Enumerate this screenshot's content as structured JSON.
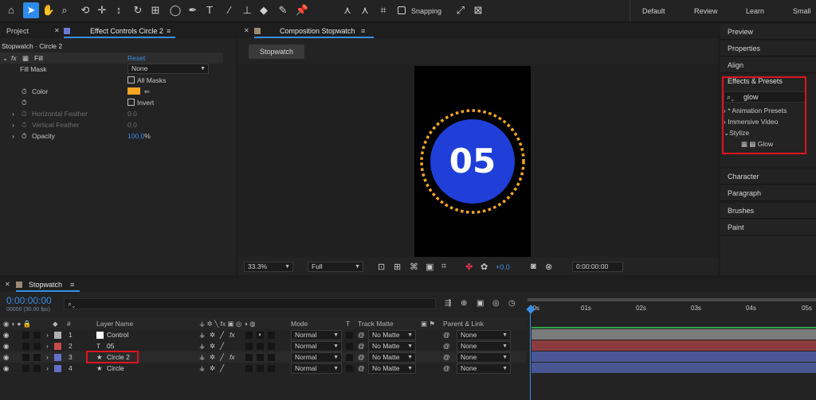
{
  "toolbar": {
    "snapping_label": "Snapping",
    "workspaces": [
      "Default",
      "Review",
      "Learn",
      "Small S"
    ]
  },
  "project_tab": "Project",
  "effect_controls": {
    "tab": "Effect Controls Circle 2",
    "layer_path": "Stopwatch · Circle 2",
    "effect_name": "Fill",
    "reset_label": "Reset",
    "fill_mask_label": "Fill Mask",
    "fill_mask_value": "None",
    "all_masks_label": "All Masks",
    "color_label": "Color",
    "color_value": "#f6a623",
    "invert_label": "Invert",
    "horizontal_feather_label": "Horizontal Feather",
    "horizontal_feather_value": "0.0",
    "vertical_feather_label": "Vertical Feather",
    "vertical_feather_value": "0.0",
    "opacity_label": "Opacity",
    "opacity_value": "100.0",
    "opacity_unit": "%"
  },
  "composition": {
    "tab": "Composition Stopwatch",
    "button": "Stopwatch",
    "number": "05",
    "zoom": "33.3%",
    "resolution": "Full",
    "exposure": "+0.0",
    "timecode": "0:00:00:00",
    "circle_color": "#1f3fd8",
    "ring_color": "#f6a623"
  },
  "right_panels": {
    "top": [
      "Preview",
      "Properties",
      "Align"
    ],
    "effects_title": "Effects & Presets",
    "search_value": "glow",
    "tree": [
      "* Animation Presets",
      "Immersive Video",
      "Stylize",
      "Glow"
    ],
    "bottom": [
      "Character",
      "Paragraph",
      "Brushes",
      "Paint"
    ]
  },
  "timeline": {
    "tab": "Stopwatch",
    "time": "0:00:00:00",
    "fps": "00000 (30.00 fps)",
    "headers": {
      "num": "#",
      "layer_name": "Layer Name",
      "mode": "Mode",
      "t": "T",
      "track_matte": "Track Matte",
      "parent": "Parent & Link"
    },
    "ruler": [
      "00s",
      "01s",
      "02s",
      "03s",
      "04s",
      "05s"
    ],
    "layers": [
      {
        "num": "1",
        "name": "Control",
        "mode": "Normal",
        "matte": "No Matte",
        "parent": "None",
        "label_color": "#b1b1b1",
        "bar_color": "#7b7b7b",
        "type": "solid"
      },
      {
        "num": "2",
        "name": "05",
        "mode": "Normal",
        "matte": "No Matte",
        "parent": "None",
        "label_color": "#c84a4a",
        "bar_color": "#8a3c3f",
        "type": "text"
      },
      {
        "num": "3",
        "name": "Circle 2",
        "mode": "Normal",
        "matte": "No Matte",
        "parent": "None",
        "label_color": "#6470c8",
        "bar_color": "#4a5694",
        "type": "shape"
      },
      {
        "num": "4",
        "name": "Circle",
        "mode": "Normal",
        "matte": "No Matte",
        "parent": "None",
        "label_color": "#6470c8",
        "bar_color": "#4a5694",
        "type": "shape"
      }
    ]
  }
}
